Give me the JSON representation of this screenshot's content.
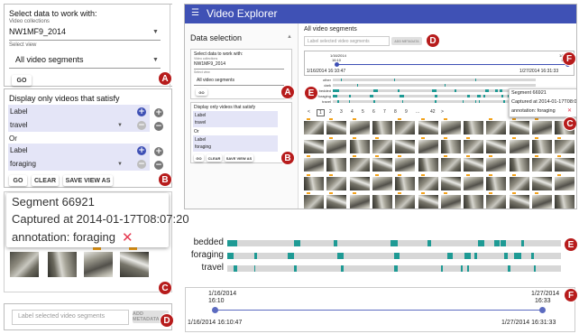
{
  "panelA": {
    "title": "Select data to work with:",
    "collections_label": "Video collections",
    "collection_value": "NW1MF9_2014",
    "view_label": "Select view",
    "view_value": "All video segments",
    "go": "GO",
    "badge": "A"
  },
  "panelB": {
    "title": "Display only videos that satisfy",
    "cond1_label": "Label",
    "cond1_value": "travel",
    "or": "Or",
    "cond2_label": "Label",
    "cond2_value": "foraging",
    "go": "GO",
    "clear": "CLEAR",
    "save": "SAVE VIEW AS",
    "badge": "B"
  },
  "panelC": {
    "segment": "Segment 66921",
    "captured": "Captured at 2014-01-17T08:07:20",
    "annotation": "annotation: foraging",
    "badge": "C"
  },
  "panelD": {
    "placeholder": "Label selected video segments",
    "add": "ADD METADATA",
    "badge": "D"
  },
  "app": {
    "title": "Video Explorer",
    "sidebar_title": "Data selection",
    "all_segments": "All video segments",
    "badge_e": "E",
    "badge_f": "F"
  },
  "pages": [
    "<",
    "1",
    "2",
    "3",
    "4",
    "5",
    "6",
    "7",
    "8",
    "9",
    "...",
    "42",
    ">"
  ],
  "mini_timeline_rows": [
    "other",
    "dark",
    "bedded",
    "foraging",
    "travel"
  ],
  "panelE": {
    "rows": [
      "bedded",
      "foraging",
      "travel"
    ],
    "badge": "E"
  },
  "panelF": {
    "start_date": "1/16/2014",
    "start_time": "16:10",
    "end_date": "1/27/2014",
    "end_time": "16:33",
    "range_start": "1/16/2014 16:10:47",
    "range_end": "1/27/2014 16:31:33",
    "badge": "F"
  },
  "colors": {
    "header": "#3f51b5",
    "accent": "#3f51b5",
    "timeline_tick": "#1e9a94",
    "badge": "#b71c1c",
    "condition_bg": "#e4e5f7"
  }
}
